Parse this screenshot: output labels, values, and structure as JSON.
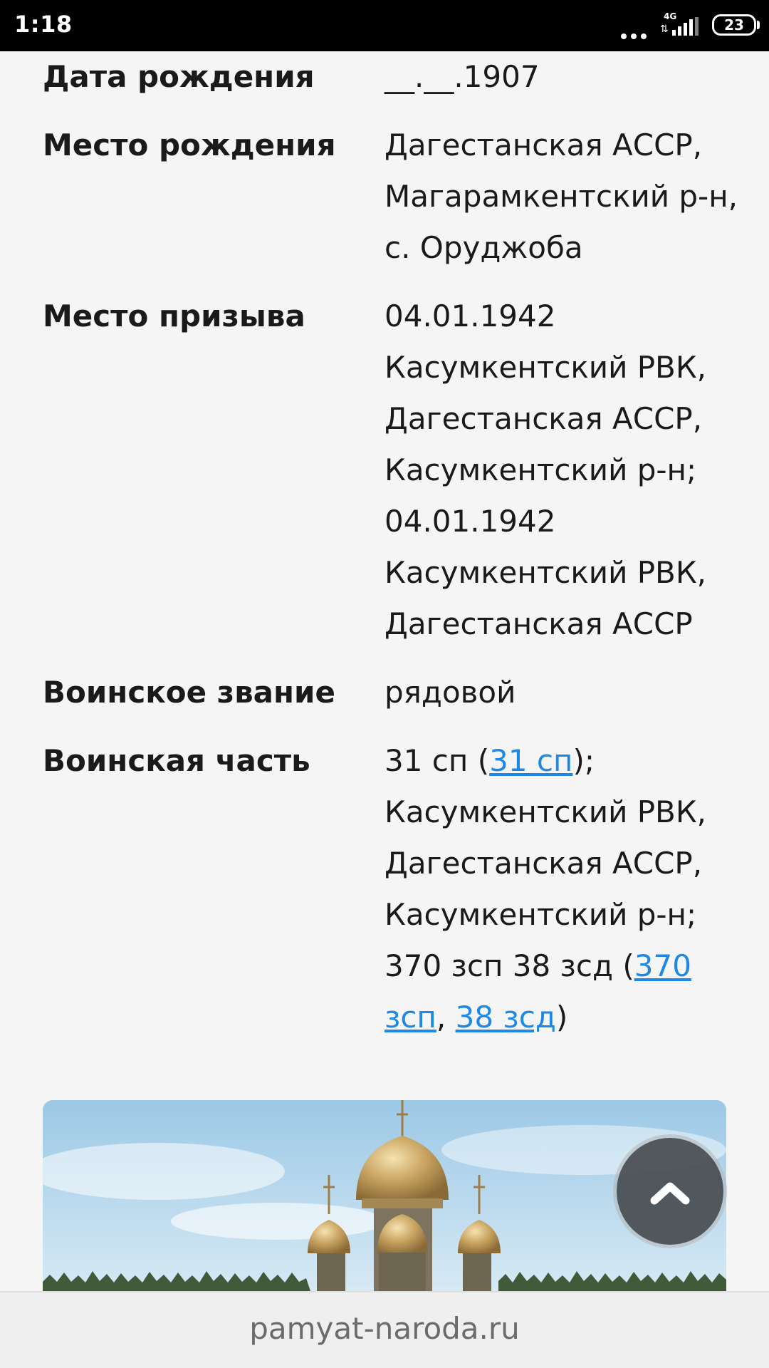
{
  "status_bar": {
    "time": "1:18",
    "network": "4G",
    "battery": "23"
  },
  "rows": [
    {
      "label": "Дата рождения",
      "lines": [
        [
          {
            "text": "__.__.1907"
          }
        ]
      ]
    },
    {
      "label": "Место рождения",
      "lines": [
        [
          {
            "text": "Дагестанская АССР,"
          }
        ],
        [
          {
            "text": "Магарамкентский р-н,"
          }
        ],
        [
          {
            "text": "с. Оруджоба"
          }
        ]
      ]
    },
    {
      "label": "Место призыва",
      "lines": [
        [
          {
            "text": "04.01.1942"
          }
        ],
        [
          {
            "text": "Касумкентский РВК,"
          }
        ],
        [
          {
            "text": "Дагестанская АССР,"
          }
        ],
        [
          {
            "text": "Касумкентский р-н;"
          }
        ],
        [
          {
            "text": "04.01.1942"
          }
        ],
        [
          {
            "text": "Касумкентский РВК,"
          }
        ],
        [
          {
            "text": "Дагестанская АССР"
          }
        ]
      ]
    },
    {
      "label": "Воинское звание",
      "lines": [
        [
          {
            "text": "рядовой"
          }
        ]
      ]
    },
    {
      "label": "Воинская часть",
      "lines": [
        [
          {
            "text": "31 сп ("
          },
          {
            "text": "31 сп",
            "link": true
          },
          {
            "text": ");"
          }
        ],
        [
          {
            "text": "Касумкентский РВК,"
          }
        ],
        [
          {
            "text": "Дагестанская АССР,"
          }
        ],
        [
          {
            "text": "Касумкентский р-н;"
          }
        ],
        [
          {
            "text": "370 зсп 38 зсд ("
          },
          {
            "text": "370",
            "link": true
          }
        ],
        [
          {
            "text": "зсп",
            "link": true
          },
          {
            "text": ", "
          },
          {
            "text": "38 зсд",
            "link": true
          },
          {
            "text": ")"
          }
        ]
      ]
    }
  ],
  "banner": {
    "icon": "cathedral-image"
  },
  "scroll_top": {
    "icon": "chevron-up-icon"
  },
  "url_bar": {
    "url": "pamyat-naroda.ru"
  },
  "colors": {
    "link": "#1e88e5",
    "background": "#f5f5f5"
  }
}
